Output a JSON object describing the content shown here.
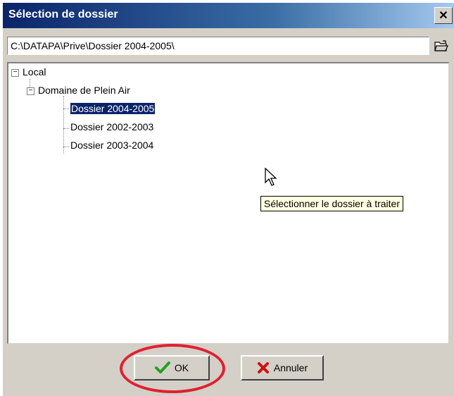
{
  "window": {
    "title": "Sélection de dossier",
    "close_label": "✕"
  },
  "path": {
    "value": "C:\\DATAPA\\Prive\\Dossier 2004-2005\\"
  },
  "tree": {
    "root": {
      "label": "Local",
      "expander": "−"
    },
    "domain": {
      "label": "Domaine de Plein Air",
      "expander": "−"
    },
    "folders": [
      {
        "label": "Dossier 2004-2005",
        "selected": true
      },
      {
        "label": "Dossier 2002-2003",
        "selected": false
      },
      {
        "label": "Dossier 2003-2004",
        "selected": false
      }
    ]
  },
  "tooltip": {
    "text": "Sélectionner le dossier à traiter"
  },
  "buttons": {
    "ok_label": "OK",
    "cancel_label": "Annuler"
  },
  "colors": {
    "title_bar": "#0a246a",
    "selection": "#0a246a",
    "ok_check": "#22a022",
    "cancel_x": "#d01010",
    "highlight": "#e02030"
  },
  "icons": {
    "browse": "folder-open-icon",
    "ok": "checkmark-icon",
    "cancel": "x-mark-icon",
    "pointer": "mouse-cursor-icon"
  }
}
